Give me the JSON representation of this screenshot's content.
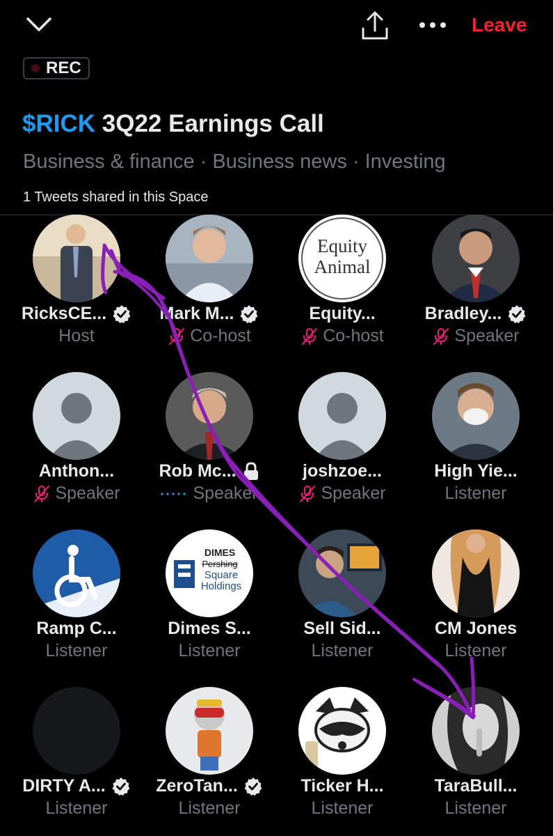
{
  "header": {
    "leave_label": "Leave",
    "rec_label": "REC",
    "title_cashtag": "$RICK",
    "title_rest": " 3Q22 Earnings Call",
    "topics": "Business & finance · Business news · Investing",
    "shared_note": "1 Tweets shared in this Space"
  },
  "colors": {
    "accent": "#1d9bf0",
    "leave": "#f4212e",
    "muted": "#71767b",
    "annotation": "#8a1fb8"
  },
  "participants": [
    {
      "name": "RicksCE...",
      "role": "Host",
      "verified": true,
      "muted": false,
      "avatar": "photo-man-suit"
    },
    {
      "name": "Mark M...",
      "role": "Co-host",
      "verified": true,
      "muted": true,
      "avatar": "photo-man-sky"
    },
    {
      "name": "Equity...",
      "role": "Co-host",
      "verified": false,
      "muted": true,
      "avatar": "logo-equity-animal",
      "avatar_text_1": "Equity",
      "avatar_text_2": "Animal"
    },
    {
      "name": "Bradley...",
      "role": "Speaker",
      "verified": true,
      "muted": true,
      "avatar": "photo-man-tie"
    },
    {
      "name": "Anthon...",
      "role": "Speaker",
      "verified": false,
      "muted": true,
      "avatar": "default-avatar"
    },
    {
      "name": "Rob Mc...",
      "role": "Speaker",
      "verified": false,
      "muted": false,
      "locked": true,
      "speaking": true,
      "avatar": "photo-man-red-tie"
    },
    {
      "name": "joshzoe...",
      "role": "Speaker",
      "verified": false,
      "muted": true,
      "avatar": "default-avatar"
    },
    {
      "name": "High Yie...",
      "role": "Listener",
      "verified": false,
      "muted": false,
      "avatar": "photo-man-mask"
    },
    {
      "name": "Ramp C...",
      "role": "Listener",
      "verified": false,
      "muted": false,
      "avatar": "logo-wheelchair"
    },
    {
      "name": "Dimes S...",
      "role": "Listener",
      "verified": false,
      "muted": false,
      "avatar": "logo-dimes-square",
      "avatar_text_1": "DIMES",
      "avatar_text_2": "Pershing",
      "avatar_text_3": "Square",
      "avatar_text_4": "Holdings"
    },
    {
      "name": "Sell Sid...",
      "role": "Listener",
      "verified": false,
      "muted": false,
      "avatar": "photo-trader"
    },
    {
      "name": "CM Jones",
      "role": "Listener",
      "verified": false,
      "muted": false,
      "avatar": "photo-woman"
    },
    {
      "name": "DIRTY A...",
      "role": "Listener",
      "verified": true,
      "muted": false,
      "avatar": "dark-avatar"
    },
    {
      "name": "ZeroTan...",
      "role": "Listener",
      "verified": true,
      "muted": false,
      "avatar": "nft-character"
    },
    {
      "name": "Ticker H...",
      "role": "Listener",
      "verified": false,
      "muted": false,
      "avatar": "raccoon-logo"
    },
    {
      "name": "TaraBull...",
      "role": "Listener",
      "verified": false,
      "muted": false,
      "avatar": "photo-woman-bw"
    }
  ]
}
